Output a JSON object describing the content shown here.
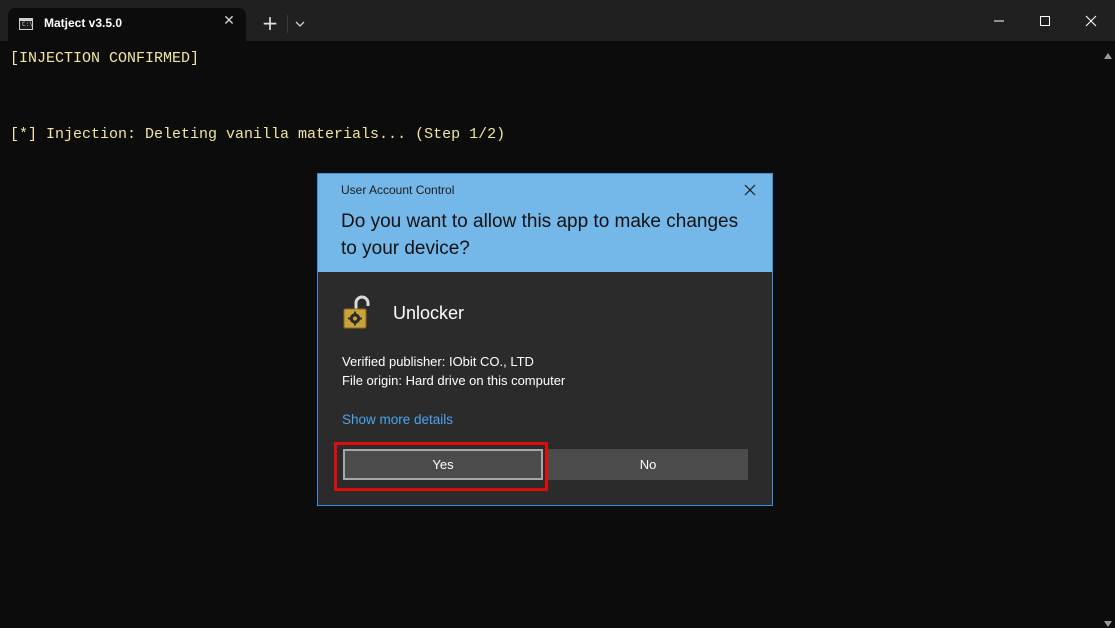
{
  "window": {
    "tab_title": "Matject v3.5.0",
    "tab_icon": "terminal-icon",
    "tab_icon_text": "C:\\",
    "new_tab_symbol": "+",
    "close_tab_symbol": "✕"
  },
  "console": {
    "lines": [
      "[INJECTION CONFIRMED]",
      "[*] Injection: Deleting vanilla materials... (Step 1/2)"
    ],
    "text_color": "#f2e6a0"
  },
  "uac": {
    "caption": "User Account Control",
    "question": "Do you want to allow this app to make changes to your device?",
    "app_name": "Unlocker",
    "app_icon": "unlocked-padlock-icon",
    "publisher": "Verified publisher: IObit CO., LTD",
    "origin": "File origin: Hard drive on this computer",
    "more_details": "Show more details",
    "yes_label": "Yes",
    "no_label": "No",
    "header_color": "#74b8ea",
    "highlight_color": "#e00b0b"
  }
}
